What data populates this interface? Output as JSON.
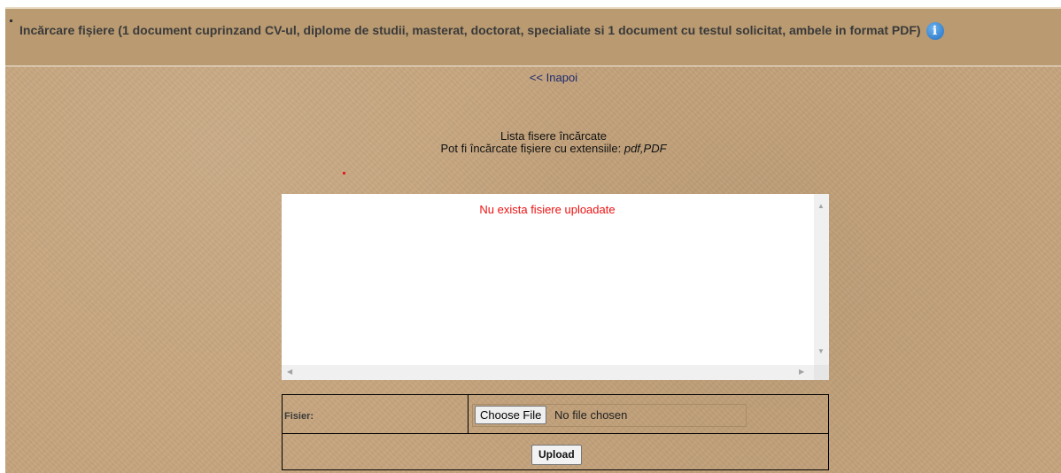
{
  "header": {
    "title": "Incărcare fișiere (1 document cuprinzand CV-ul, diplome de studii, masterat, doctorat, specialiate si 1 document cu testul solicitat, ambele in format PDF)",
    "info_icon": "info-icon",
    "info_glyph": "i"
  },
  "nav": {
    "back_label": "<< Inapoi"
  },
  "files": {
    "list_title": "Lista fisere încărcate",
    "extensions_prefix": "Pot fi încărcate fișiere cu extensiile: ",
    "extensions": "pdf,PDF",
    "empty_message": "Nu exista fisiere uploadate"
  },
  "form": {
    "file_label": "Fisier:",
    "choose_button": "Choose File",
    "no_file_text": "No file chosen",
    "upload_button": "Upload"
  },
  "colors": {
    "background": "#c6a57d",
    "header": "#b99a71",
    "error_text": "#ee1111",
    "info_icon": "#1f6fc2"
  }
}
